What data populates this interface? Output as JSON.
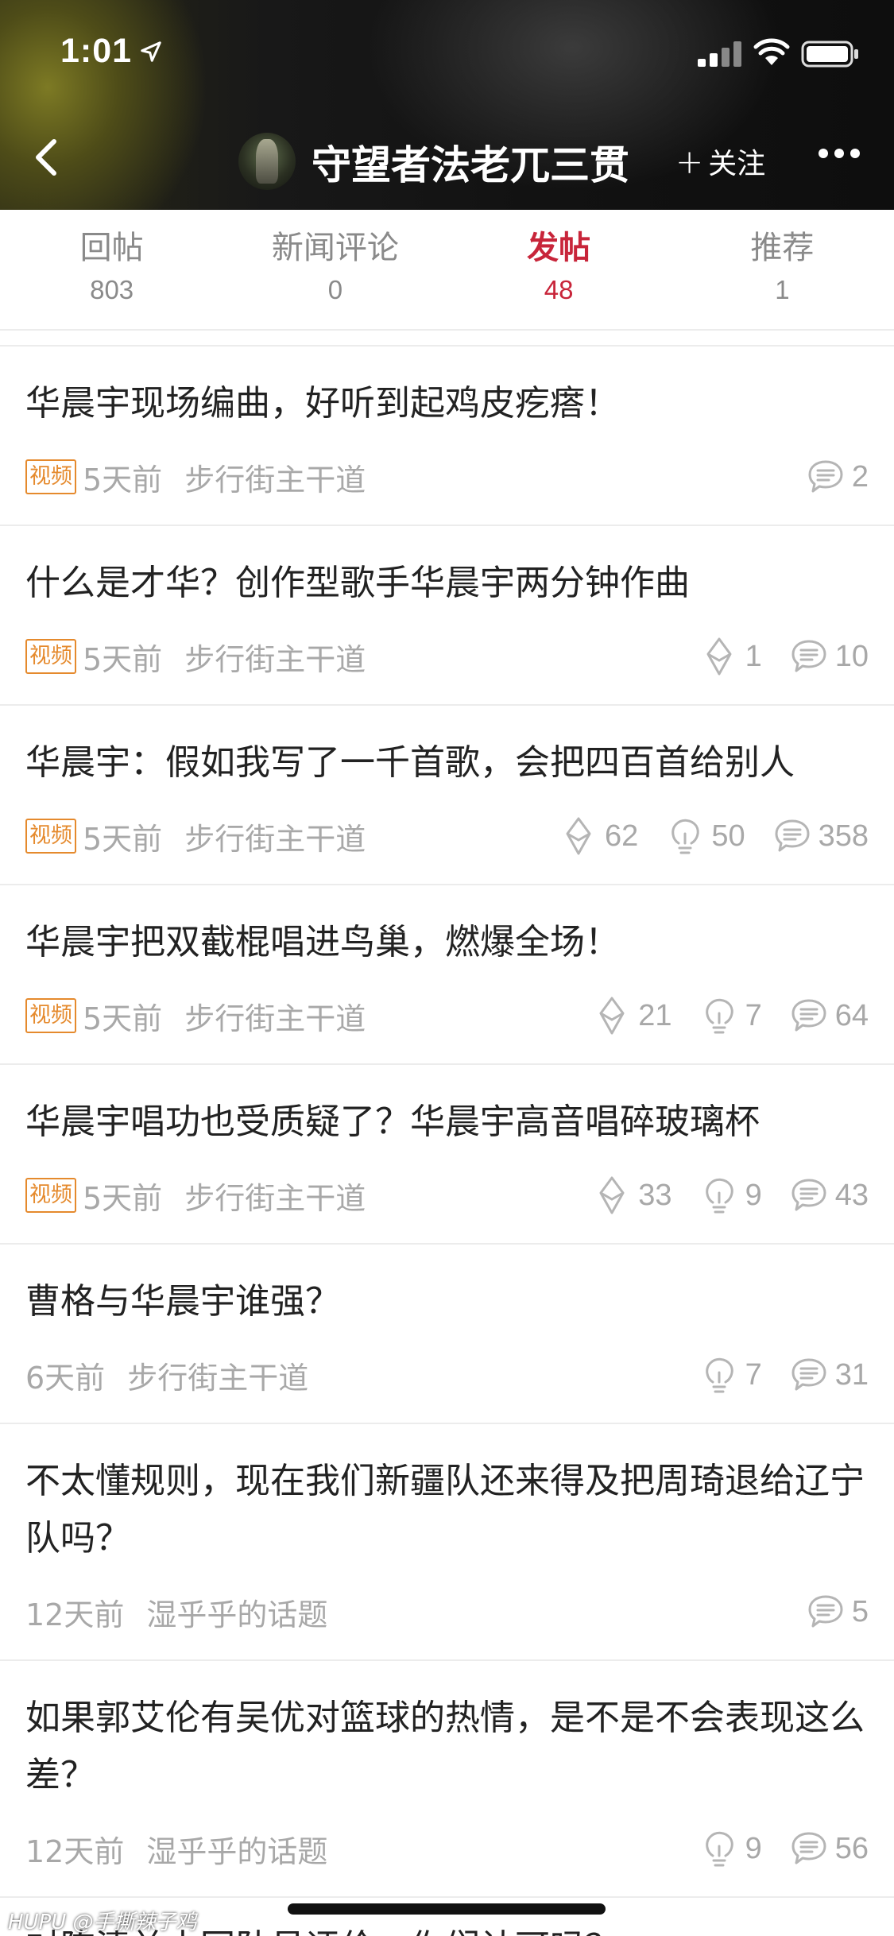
{
  "status_bar": {
    "time": "1:01"
  },
  "nav": {
    "user_name": "守望者法老兀三贯",
    "follow_label": "关注"
  },
  "tabs": [
    {
      "label": "回帖",
      "count": "803",
      "active": false
    },
    {
      "label": "新闻评论",
      "count": "0",
      "active": false
    },
    {
      "label": "发帖",
      "count": "48",
      "active": true
    },
    {
      "label": "推荐",
      "count": "1",
      "active": false
    }
  ],
  "colors": {
    "accent": "#c8253a",
    "badge": "#e58a2d",
    "meta_text": "#a8a8a8"
  },
  "posts": [
    {
      "title": "华晨宇现场编曲，好听到起鸡皮疙瘩！",
      "badge": "视频",
      "time": "5天前",
      "board": "步行街主干道",
      "recommend": "",
      "light": "",
      "replies": "2"
    },
    {
      "title": "什么是才华？创作型歌手华晨宇两分钟作曲",
      "badge": "视频",
      "time": "5天前",
      "board": "步行街主干道",
      "recommend": "1",
      "light": "",
      "replies": "10"
    },
    {
      "title": "华晨宇：假如我写了一千首歌，会把四百首给别人",
      "badge": "视频",
      "time": "5天前",
      "board": "步行街主干道",
      "recommend": "62",
      "light": "50",
      "replies": "358"
    },
    {
      "title": "华晨宇把双截棍唱进鸟巢，燃爆全场！",
      "badge": "视频",
      "time": "5天前",
      "board": "步行街主干道",
      "recommend": "21",
      "light": "7",
      "replies": "64"
    },
    {
      "title": "华晨宇唱功也受质疑了？华晨宇高音唱碎玻璃杯",
      "badge": "视频",
      "time": "5天前",
      "board": "步行街主干道",
      "recommend": "33",
      "light": "9",
      "replies": "43"
    },
    {
      "title": "曹格与华晨宇谁强？",
      "badge": "",
      "time": "6天前",
      "board": "步行街主干道",
      "recommend": "",
      "light": "7",
      "replies": "31"
    },
    {
      "title": "不太懂规则，现在我们新疆队还来得及把周琦退给辽宁队吗？",
      "badge": "",
      "time": "12天前",
      "board": "湿乎乎的话题",
      "recommend": "",
      "light": "",
      "replies": "5"
    },
    {
      "title": "如果郭艾伦有吴优对篮球的热情，是不是不会表现这么差？",
      "badge": "",
      "time": "12天前",
      "board": "湿乎乎的话题",
      "recommend": "",
      "light": "9",
      "replies": "56"
    }
  ],
  "partial_post_title": "对陈清兰士回队员评价，你们认可吗？",
  "watermark": "HUPU @手撕辣子鸡"
}
